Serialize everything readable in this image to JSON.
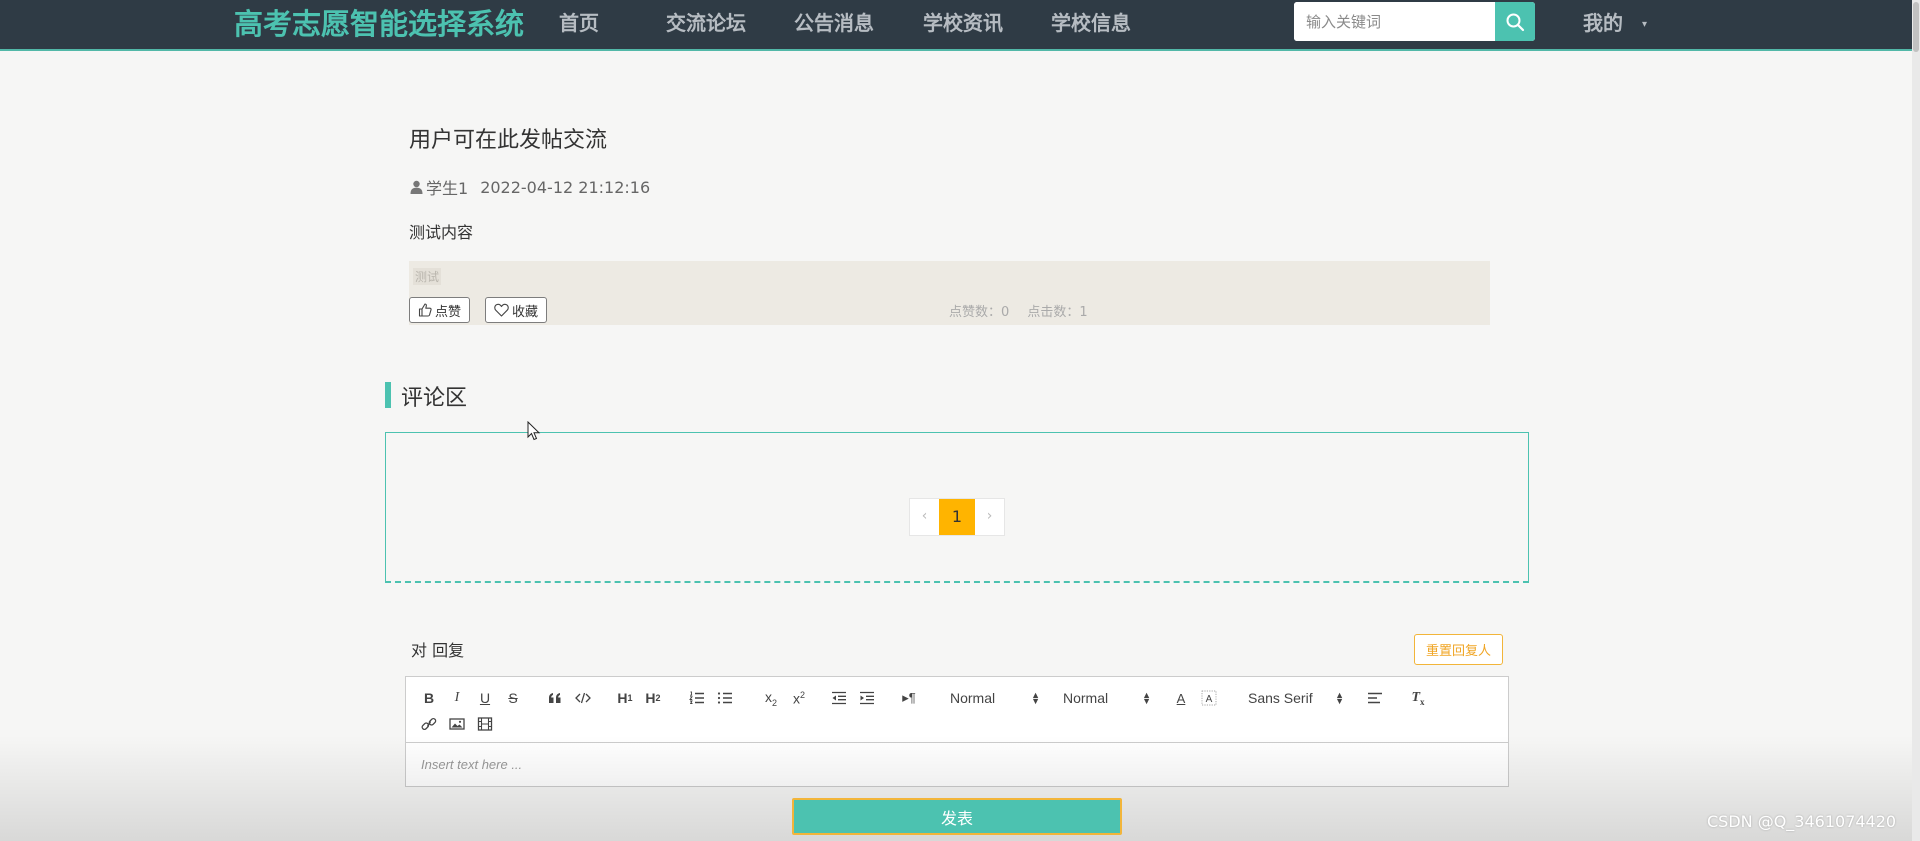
{
  "header": {
    "brand": "高考志愿智能选择系统",
    "nav": [
      "首页",
      "交流论坛",
      "公告消息",
      "学校资讯",
      "学校信息"
    ],
    "search_placeholder": "输入关键词",
    "user_menu": "我的"
  },
  "post": {
    "title": "用户可在此发帖交流",
    "author": "学生1",
    "time": "2022-04-12 21:12:16",
    "content": "测试内容",
    "tag": "测试",
    "like_label": "点赞",
    "collect_label": "收藏",
    "like_count_label": "点赞数：0",
    "click_count_label": "点击数：1"
  },
  "comments": {
    "section_title": "评论区",
    "pagination": {
      "prev": "‹",
      "current": "1",
      "next": "›"
    }
  },
  "reply": {
    "label": "对 回复",
    "reset_label": "重置回复人",
    "editor": {
      "header_size": "Normal",
      "font_size": "Normal",
      "font_family": "Sans Serif",
      "placeholder": "Insert text here ..."
    },
    "submit_label": "发表"
  },
  "watermark": "CSDN @Q_3461074420",
  "colors": {
    "nav_bg": "#2f3b45",
    "accent": "#4cc2b0",
    "page_active": "#ffb400",
    "reset_orange": "#f2b53a"
  }
}
